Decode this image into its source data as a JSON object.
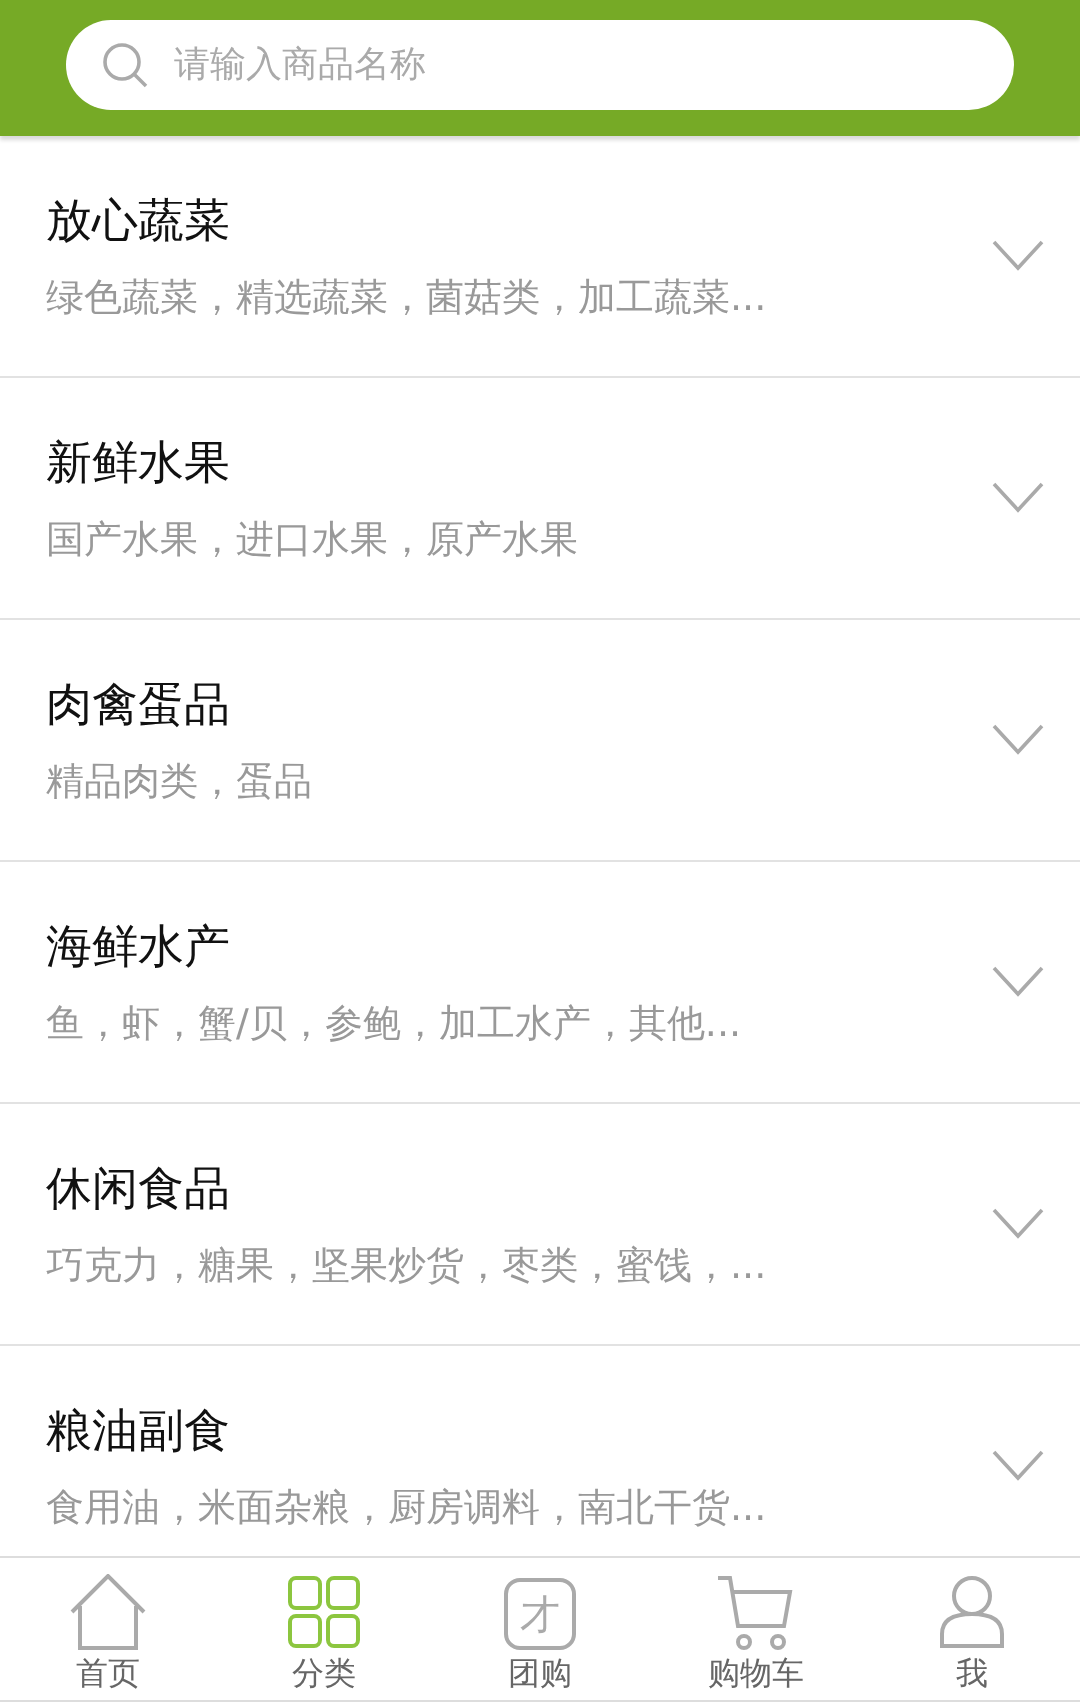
{
  "search": {
    "placeholder": "请输入商品名称"
  },
  "categories": [
    {
      "title": "放心蔬菜",
      "subtitle": "绿色蔬菜，精选蔬菜，菌菇类，加工蔬菜...",
      "expanded": false
    },
    {
      "title": "新鲜水果",
      "subtitle": "国产水果，进口水果，原产水果",
      "expanded": false
    },
    {
      "title": "肉禽蛋品",
      "subtitle": "精品肉类，蛋品",
      "expanded": false
    },
    {
      "title": "海鲜水产",
      "subtitle": "鱼，虾，蟹/贝，参鲍，加工水产，其他...",
      "expanded": false
    },
    {
      "title": "休闲食品",
      "subtitle": "巧克力，糖果，坚果炒货，枣类，蜜饯，...",
      "expanded": false
    },
    {
      "title": "粮油副食",
      "subtitle": "食用油，米面杂粮，厨房调料，南北干货...",
      "expanded": false
    }
  ],
  "tab_bar": [
    {
      "kind": "home",
      "label": "首页",
      "selected": false
    },
    {
      "kind": "grid",
      "label": "分类",
      "selected": true
    },
    {
      "kind": "group",
      "label": "团购",
      "selected": false,
      "icon_text": "才"
    },
    {
      "kind": "cart",
      "label": "购物车",
      "selected": false
    },
    {
      "kind": "user",
      "label": "我",
      "selected": false
    }
  ]
}
